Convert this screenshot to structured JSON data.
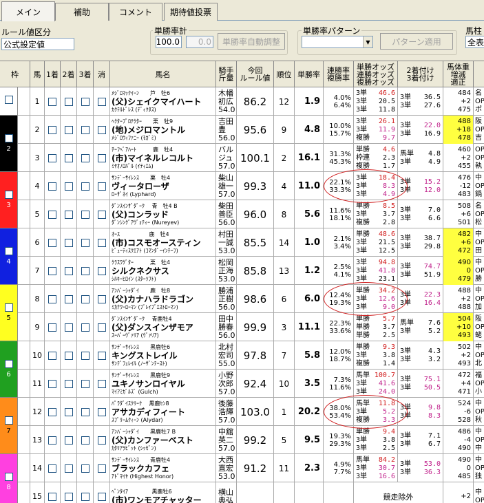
{
  "tabs": [
    "メイン",
    "補助",
    "コメント",
    "期待値投票"
  ],
  "rule_label": "ルール値区分",
  "rule_value": "公式設定値",
  "win_rate_calc": {
    "label": "単勝率計",
    "value": "100.0",
    "value2": "0.0",
    "button": "単勝率自動調整"
  },
  "pattern": {
    "label": "単勝率パターン",
    "button": "パターン適用"
  },
  "right": {
    "label": "馬柱組",
    "value": "全表"
  },
  "headers": {
    "waku": "枠",
    "uma": "馬",
    "c1": "1着",
    "c2": "2着",
    "c3": "3着",
    "kesu": "消",
    "name": "馬名",
    "jockey": "騎手\n斤量",
    "rule": "今回\nルール値",
    "rank": "順位",
    "wr": "単勝率",
    "rr": "連勝率\n複勝率",
    "odds": "単勝オッズ\n連勝オッズ\n複勝オッズ",
    "ft": "2着付け\n3着付け",
    "bw": "馬体重\n増減\n適正"
  },
  "waku_colors": [
    "#ffffff",
    "#000000",
    "#ff2020",
    "#1020e0",
    "#ffff20",
    "#20a020",
    "#ff8c1a",
    "#ff40e0"
  ],
  "rows": [
    {
      "waku": 1,
      "no": "1",
      "top": "ﾒｼﾞﾛﾏｯｸｲｰﾝ　　芦　牡6",
      "name": "(父)シェイクマイハート",
      "sub": "ｶｸﾃﾙﾄﾞﾚｽ (ﾃﾞｨｸﾀｽ)",
      "j1": "木幡",
      "j2": "初広",
      "j3": "54.0",
      "rule": "86.2",
      "rank": "12",
      "wr": "1.9",
      "r1": "4.0%",
      "r2": "6.4%",
      "o": [
        [
          "3単",
          "46.6",
          "",
          ""
        ],
        [
          "3単",
          "20.5",
          "3単",
          "36.5"
        ],
        [
          "3単",
          "11.8",
          "3単",
          "27.6"
        ]
      ],
      "oc": [
        "",
        "",
        ""
      ],
      "fc": [
        "",
        ""
      ],
      "bw": [
        "484",
        "+2",
        "475"
      ],
      "hl": false,
      "sx": [
        "名",
        "OP",
        "ポ"
      ]
    },
    {
      "waku": 2,
      "no": "2",
      "top": "ﾍｸﾀｰﾌﾟﾛﾃｸﾀｰ　　栗　牡9",
      "name": "(地)メジロマントル",
      "sub": "ﾒｼﾞﾛｳｨﾌｧﾆｰ (ﾓｶﾞﾐ)",
      "j1": "吉田",
      "j2": "豊",
      "j3": "56.0",
      "rule": "95.6",
      "rank": "9",
      "wr": "4.8",
      "r1": "10.0%",
      "r2": "15.7%",
      "o": [
        [
          "3単",
          "26.1",
          "",
          ""
        ],
        [
          "3単",
          "11.9",
          "3単",
          "22.0"
        ],
        [
          "複勝",
          "9.7",
          "3単",
          "16.9"
        ]
      ],
      "oc": [
        "mag",
        "mag",
        "mag"
      ],
      "fc": [
        "mag",
        ""
      ],
      "bw": [
        "488",
        "+18",
        "478"
      ],
      "hl": true,
      "sx": [
        "阪",
        "OP",
        "吉"
      ]
    },
    {
      "waku": 2,
      "no": "3",
      "top": "ﾁｰﾌﾍﾞｱﾊｰﾄ　　　鹿　牡4",
      "name": "(市)マイネルレコルト",
      "sub": "ﾐﾔｵﾉﾛﾙﾞﾙ (ｲﾃｨｴﾑ)",
      "j1": "バル",
      "j2": "ジュ",
      "j3": "57.0",
      "rule": "100.1",
      "rank": "2",
      "wr": "16.1",
      "r1": "31.3%",
      "r2": "45.3%",
      "o": [
        [
          "単勝",
          "4.6",
          "",
          ""
        ],
        [
          "枠連",
          "2.3",
          "馬単",
          "4.8"
        ],
        [
          "複勝",
          "1.7",
          "3単",
          "4.9"
        ]
      ],
      "oc": [
        "",
        "",
        ""
      ],
      "fc": [
        "",
        ""
      ],
      "bw": [
        "460",
        "+2",
        "455"
      ],
      "hl": false,
      "sx": [
        "OP",
        "OP",
        "執"
      ]
    },
    {
      "waku": 3,
      "no": "4",
      "top": "ｻﾝﾃﾞｰｻｲﾚﾝｽ　　栗　牡4",
      "name": "ヴィータローザ",
      "sub": "ﾛｰｻﾞﾈｲ (Lyphard)",
      "j1": "柴山",
      "j2": "雄一",
      "j3": "57.0",
      "rule": "99.3",
      "rank": "4",
      "wr": "11.0",
      "r1": "22.1%",
      "r2": "33.3%",
      "o": [
        [
          "3単",
          "18.4",
          "",
          ""
        ],
        [
          "3単",
          "8.3",
          "3単",
          "15.2"
        ],
        [
          "3単",
          "4.9",
          "3単",
          "12.0"
        ]
      ],
      "oc": [
        "mag",
        "mag",
        "mag"
      ],
      "fc": [
        "mag",
        "mag"
      ],
      "bw": [
        "476",
        "-12",
        "483"
      ],
      "hl": false,
      "sx": [
        "中",
        "OP",
        "鍋"
      ]
    },
    {
      "waku": 3,
      "no": "5",
      "top": "ﾀﾞﾝｽｲﾝｻﾞﾀﾞｰｸ　 青　牡4 B",
      "name": "(父)コンラッド",
      "sub": "ﾀﾞﾝｼﾝｸﾞｱｳﾞｫﾃｨｰ (Nureyev)",
      "j1": "柴田",
      "j2": "善臣",
      "j3": "56.0",
      "rule": "96.0",
      "rank": "8",
      "wr": "5.6",
      "r1": "11.6%",
      "r2": "18.1%",
      "o": [
        [
          "単勝",
          "8.5",
          "",
          ""
        ],
        [
          "3単",
          "3.7",
          "3単",
          "7.0"
        ],
        [
          "複勝",
          "2.8",
          "3単",
          "6.6"
        ]
      ],
      "oc": [
        "",
        "",
        ""
      ],
      "fc": [
        "",
        ""
      ],
      "bw": [
        "508",
        "+6",
        "501"
      ],
      "hl": false,
      "sx": [
        "名",
        "OP",
        "松"
      ]
    },
    {
      "waku": 4,
      "no": "6",
      "top": "ｵｰｽ　　　　　 鹿　牡4",
      "name": "(市)コスモオースティン",
      "sub": "ﾋﾞｭｰﾃｨｽｸｴｱﾄ (ｺﾏﾝﾀﾞｰｲﾝﾁｰﾌ)",
      "j1": "村田",
      "j2": "一誠",
      "j3": "53.0",
      "rule": "85.5",
      "rank": "14",
      "wr": "1.0",
      "r1": "2.1%",
      "r2": "3.4%",
      "o": [
        [
          "単勝",
          "48.6",
          "",
          ""
        ],
        [
          "3単",
          "21.5",
          "3単",
          "38.7"
        ],
        [
          "3単",
          "12.5",
          "3単",
          "29.8"
        ]
      ],
      "oc": [
        "",
        "",
        ""
      ],
      "fc": [
        "",
        ""
      ],
      "bw": [
        "482",
        "+6",
        "472"
      ],
      "hl": true,
      "sx": [
        "中",
        "OP",
        "田"
      ]
    },
    {
      "waku": 4,
      "no": "7",
      "top": "ｸﾗｽﾜｸﾞﾀｰ　　　栗　牡4",
      "name": "シルクネクサス",
      "sub": "ｼﾙｷｰﾋﾛｲﾝ (ｽﾀｰｿﾌﾄ)",
      "j1": "松岡",
      "j2": "正海",
      "j3": "53.0",
      "rule": "85.8",
      "rank": "13",
      "wr": "1.2",
      "r1": "2.5%",
      "r2": "4.1%",
      "o": [
        [
          "3単",
          "94.8",
          "",
          ""
        ],
        [
          "3単",
          "41.8",
          "3単",
          "74.7"
        ],
        [
          "3単",
          "23.1",
          "3単",
          "51.9"
        ]
      ],
      "oc": [
        "mag",
        "mag",
        ""
      ],
      "fc": [
        "mag",
        ""
      ],
      "bw": [
        "490",
        "0",
        "479"
      ],
      "hl": true,
      "sx": [
        "中",
        "OP",
        "勝"
      ]
    },
    {
      "waku": 5,
      "no": "8",
      "top": "ｱﾝﾊﾞｰｼｬﾀﾞｲ　　鹿　牡8",
      "name": "(父)カナハラドラゴン",
      "sub": "ﾐｶﾅﾜｰﾛｰﾏﾝ (ﾌﾞﾚｲﾌﾞｴｽﾄﾛｰﾏﾝ)",
      "j1": "勝浦",
      "j2": "正樹",
      "j3": "56.0",
      "rule": "98.6",
      "rank": "6",
      "wr": "6.0",
      "r1": "12.4%",
      "r2": "19.3%",
      "o": [
        [
          "単勝",
          "34.2",
          "",
          ""
        ],
        [
          "3単",
          "12.6",
          "3単",
          "22.3"
        ],
        [
          "3単",
          "9.0",
          "3単",
          "16.4"
        ]
      ],
      "oc": [
        "mag",
        "mag",
        "mag"
      ],
      "fc": [
        "mag",
        "mag"
      ],
      "bw": [
        "488",
        "+2",
        "488"
      ],
      "hl": false,
      "sx": [
        "中",
        "OP",
        "加"
      ]
    },
    {
      "waku": 5,
      "no": "9",
      "top": "ﾀﾞﾝｽｲﾝｻﾞﾀﾞｰｸ　 青鹿牡4",
      "name": "(父)ダンスインザモア",
      "sub": "ｽｰﾊﾟｰｳﾞｧﾘｱ (ｳﾞｧﾘｱ)",
      "j1": "田中",
      "j2": "勝春",
      "j3": "56.0",
      "rule": "99.9",
      "rank": "3",
      "wr": "11.1",
      "r1": "22.3%",
      "r2": "33.6%",
      "o": [
        [
          "単勝",
          "5.7",
          "",
          ""
        ],
        [
          "単勝",
          "3.7",
          "馬単",
          "7.6"
        ],
        [
          "単勝",
          "2.5",
          "3単",
          "5.2"
        ]
      ],
      "oc": [
        "",
        "",
        ""
      ],
      "fc": [
        "",
        ""
      ],
      "bw": [
        "504",
        "+10",
        "493"
      ],
      "hl": true,
      "sx": [
        "阪",
        "OP",
        "蛯"
      ]
    },
    {
      "waku": 6,
      "no": "10",
      "top": "ｻﾝﾃﾞｰｻｲﾚﾝｽ　　黒鹿牡6",
      "name": "キングストレイル",
      "sub": "ｻﾝﾃﾞﾌｪﾚｲﾙ (ﾉｰｻﾞﾝﾃｰｽﾄ)",
      "j1": "北村",
      "j2": "宏司",
      "j3": "55.0",
      "rule": "97.8",
      "rank": "7",
      "wr": "5.8",
      "r1": "12.0%",
      "r2": "18.7%",
      "o": [
        [
          "単勝",
          "9.3",
          "",
          ""
        ],
        [
          "3単",
          "3.8",
          "3単",
          "4.3"
        ],
        [
          "複勝",
          "1.4",
          "3単",
          "3.2"
        ]
      ],
      "oc": [
        "",
        "",
        ""
      ],
      "fc": [
        "",
        ""
      ],
      "bw": [
        "502",
        "+2",
        "493"
      ],
      "hl": false,
      "sx": [
        "中",
        "OP",
        "北"
      ]
    },
    {
      "waku": 6,
      "no": "11",
      "top": "ｻﾝﾃﾞｰｻｲﾚﾝｽ　　黒鹿牡9",
      "name": "ユキノサンロイヤル",
      "sub": "ﾏｲｱﾐｶﾞﾙｽﾞ (Gulch)",
      "j1": "小野",
      "j2": "次郎",
      "j3": "57.0",
      "rule": "92.4",
      "rank": "10",
      "wr": "3.5",
      "r1": "7.3%",
      "r2": "11.6%",
      "o": [
        [
          "馬単",
          "100.7",
          "",
          ""
        ],
        [
          "3単",
          "41.6",
          "3単",
          "75.1"
        ],
        [
          "3単",
          "24.0",
          "3単",
          "50.5"
        ]
      ],
      "oc": [
        "mag",
        "mag",
        "mag"
      ],
      "fc": [
        "mag",
        "mag"
      ],
      "bw": [
        "472",
        "+4",
        "471"
      ],
      "hl": false,
      "sx": [
        "福",
        "OP",
        "小"
      ]
    },
    {
      "waku": 7,
      "no": "12",
      "top": "ﾊﾟﾗﾀﾞｲｽｸﾘｰｸ　 黒鹿ｾﾝ8",
      "name": "アサカディフィート",
      "sub": "ｽﾌﾟﾘｰﾑｸｨｰﾝ (Alydar)",
      "j1": "後藤",
      "j2": "浩輝",
      "j3": "57.0",
      "rule": "103.0",
      "rank": "1",
      "wr": "20.2",
      "r1": "38.0%",
      "r2": "53.4%",
      "o": [
        [
          "馬単",
          "11.8",
          "",
          ""
        ],
        [
          "3単",
          "5.2",
          "3単",
          "9.8"
        ],
        [
          "複勝",
          "3.3",
          "3単",
          "8.3"
        ]
      ],
      "oc": [
        "mag",
        "mag",
        "mag"
      ],
      "fc": [
        "mag",
        "mag"
      ],
      "bw": [
        "524",
        "-6",
        "528"
      ],
      "hl": false,
      "sx": [
        "中",
        "OP",
        "秋"
      ]
    },
    {
      "waku": 7,
      "no": "13",
      "top": "ｱﾝﾊﾞｰｼｬﾀﾞｲ　　黒鹿牡7 B",
      "name": "(父)カンファーベスト",
      "sub": "ｶﾀﾘｱﾗﾋﾞｯﾄ (ｼｯｾﾞﾝ)",
      "j1": "中舘",
      "j2": "英二",
      "j3": "57.0",
      "rule": "99.2",
      "rank": "5",
      "wr": "9.5",
      "r1": "19.3%",
      "r2": "29.3%",
      "o": [
        [
          "単勝",
          "9.4",
          "",
          ""
        ],
        [
          "3単",
          "3.8",
          "3単",
          "7.1"
        ],
        [
          "3単",
          "2.5",
          "3単",
          "6.7"
        ]
      ],
      "oc": [
        "",
        "",
        ""
      ],
      "fc": [
        "",
        ""
      ],
      "bw": [
        "486",
        "-4",
        "490"
      ],
      "hl": false,
      "sx": [
        "中",
        "OP",
        "中"
      ]
    },
    {
      "waku": 8,
      "no": "14",
      "top": "ｻﾝﾃﾞｰｻｲﾚﾝｽ　　青鹿牡4",
      "name": "ブラックカフェ",
      "sub": "ｱﾄﾞﾏｲﾔ (Highest Honor)",
      "j1": "大西",
      "j2": "直宏",
      "j3": "53.0",
      "rule": "91.2",
      "rank": "11",
      "wr": "2.3",
      "r1": "4.9%",
      "r2": "7.7%",
      "o": [
        [
          "馬単",
          "84.2",
          "",
          ""
        ],
        [
          "3単",
          "30.7",
          "3単",
          "53.0"
        ],
        [
          "3単",
          "16.6",
          "3単",
          "36.3"
        ]
      ],
      "oc": [
        "mag",
        "mag",
        "mag"
      ],
      "fc": [
        "mag",
        "mag"
      ],
      "bw": [
        "490",
        "0",
        "485"
      ],
      "hl": false,
      "sx": [
        "中",
        "OP",
        "独"
      ]
    },
    {
      "waku": 8,
      "no": "15",
      "top": "ﾍﾟﾝﾀｲｱ　　　　 黒鹿牡6",
      "name": "(市)ワンモアチャッター",
      "sub": "",
      "j1": "横山",
      "j2": "典弘",
      "j3": "",
      "rule": "",
      "rank": "",
      "wr": "",
      "r1": "",
      "r2": "",
      "exclude": "競走除外",
      "o": [],
      "oc": [],
      "fc": [],
      "bw": [
        "",
        "+2",
        ""
      ],
      "hl": false,
      "sx": [
        "中",
        "OP",
        ""
      ]
    }
  ]
}
